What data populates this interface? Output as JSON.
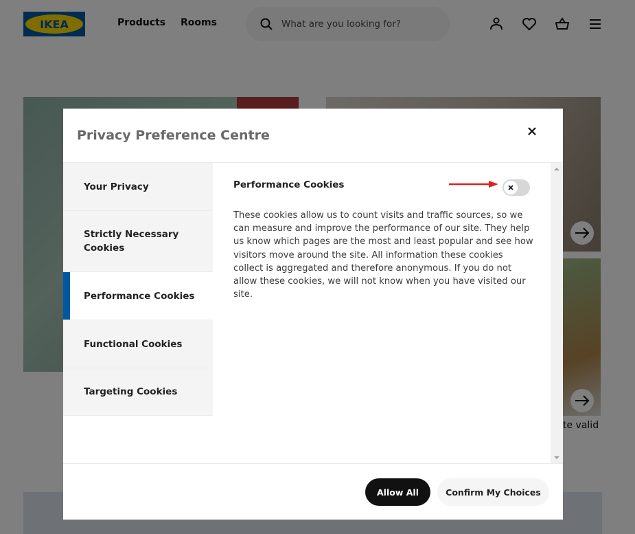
{
  "header": {
    "logo_text": "IKEA",
    "nav": [
      {
        "label": "Products"
      },
      {
        "label": "Rooms"
      }
    ],
    "search": {
      "placeholder": "What are you looking for?",
      "value": ""
    },
    "icons": [
      "account-icon",
      "heart-icon",
      "basket-icon",
      "menu-icon"
    ]
  },
  "background": {
    "partial_caption": "te valid"
  },
  "modal": {
    "title": "Privacy Preference Centre",
    "close_label": "×",
    "menu": [
      {
        "label": "Your Privacy",
        "active": false
      },
      {
        "label": "Strictly Necessary Cookies",
        "active": false
      },
      {
        "label": "Performance Cookies",
        "active": true
      },
      {
        "label": "Functional Cookies",
        "active": false
      },
      {
        "label": "Targeting Cookies",
        "active": false
      }
    ],
    "section": {
      "title": "Performance Cookies",
      "toggle_state": "off",
      "toggle_knob": "×",
      "description": "These cookies allow us to count visits and traffic sources, so we can measure and improve the performance of our site. They help us know which pages are the most and least popular and see how visitors move around the site. All information these cookies collect is aggregated and therefore anonymous. If you do not allow these cookies, we will not know when you have visited our site."
    },
    "footer": {
      "allow_all": "Allow All",
      "confirm": "Confirm My Choices"
    }
  },
  "colors": {
    "ikea_blue": "#0058a3",
    "ikea_yellow": "#ffdb00",
    "annotation_arrow": "#e02020"
  }
}
